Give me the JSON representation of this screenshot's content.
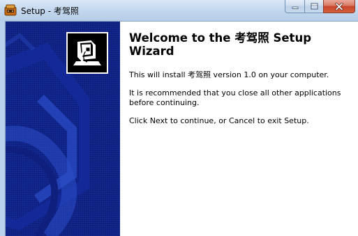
{
  "window": {
    "title": "Setup - 考驾照"
  },
  "controls": {
    "minimize_icon": "minimize-icon",
    "maximize_icon": "maximize-icon",
    "close_icon": "close-icon"
  },
  "wizard": {
    "heading": "Welcome to the 考驾照 Setup Wizard",
    "install_text": "This will install 考驾照 version 1.0 on your computer.",
    "recommend_text": "It is recommended that you close all other applications before continuing.",
    "continue_text": "Click Next to continue, or Cancel to exit Setup."
  },
  "colors": {
    "banner_bg": "#0e1f7e",
    "banner_pattern": "#1a3aa8",
    "frame": "#b9d1ea",
    "close_button": "#c7452a"
  }
}
